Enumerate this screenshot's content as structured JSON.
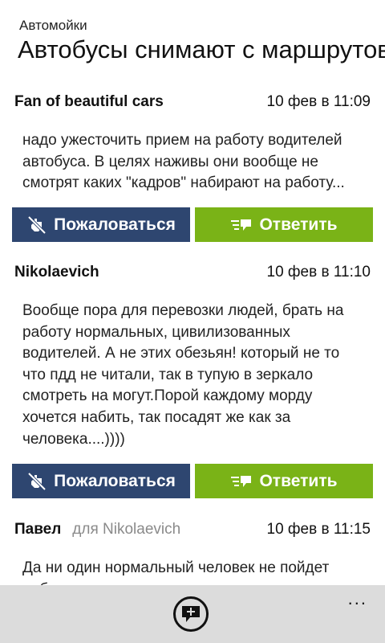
{
  "header": {
    "app_title": "Автомойки",
    "page_title": "Автобусы снимают с маршрутов"
  },
  "buttons": {
    "report_label": "Пожаловаться",
    "reply_label": "Ответить"
  },
  "comments": [
    {
      "author": "Fan of beautiful cars",
      "reply_to": "",
      "date": "10 фев в 11:09",
      "text": "надо ужесточить прием на работу водителей автобуса. В целях наживы они вообще не смотрят каких \"кадров\" набирают на работу..."
    },
    {
      "author": "Nikolaevich",
      "reply_to": "",
      "date": "10 фев в 11:10",
      "text": "Вообще пора для перевозки людей, брать на работу нормальных, цивилизованных водителей. А не этих обезьян! который не то что пдд не читали, так в тупую в зеркало смотреть на могут.Порой каждому морду хочется набить, так посадят же как за человека....))))"
    },
    {
      "author": "Павел",
      "reply_to": "для Nikolaevich",
      "date": "10 фев в 11:15",
      "text": "Да ни один нормальный человек не пойдет работать за такие деньги"
    }
  ],
  "appbar": {
    "add_icon": "add-comment-icon",
    "more_label": "..."
  },
  "colors": {
    "report_button": "#2e4670",
    "reply_button": "#7ab317",
    "appbar": "#dcdcdc"
  }
}
